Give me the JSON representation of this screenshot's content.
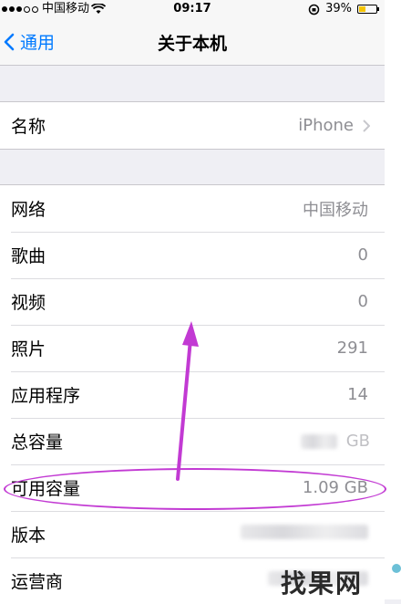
{
  "status_bar": {
    "carrier": "中国移动",
    "time": "09:17",
    "battery": "39%"
  },
  "nav": {
    "back_label": "通用",
    "title": "关于本机"
  },
  "name_row": {
    "label": "名称",
    "value": "iPhone"
  },
  "rows": [
    {
      "label": "网络",
      "value": "中国移动"
    },
    {
      "label": "歌曲",
      "value": "0"
    },
    {
      "label": "视频",
      "value": "0"
    },
    {
      "label": "照片",
      "value": "291"
    },
    {
      "label": "应用程序",
      "value": "14"
    },
    {
      "label": "总容量",
      "value": "GB"
    },
    {
      "label": "可用容量",
      "value": "1.09 GB"
    },
    {
      "label": "版本",
      "value": ""
    },
    {
      "label": "运营商",
      "value": ""
    }
  ],
  "watermark": "找果网",
  "colors": {
    "accent": "#007aff",
    "annotation": "#c23ad3",
    "battery": "#f5c400"
  }
}
